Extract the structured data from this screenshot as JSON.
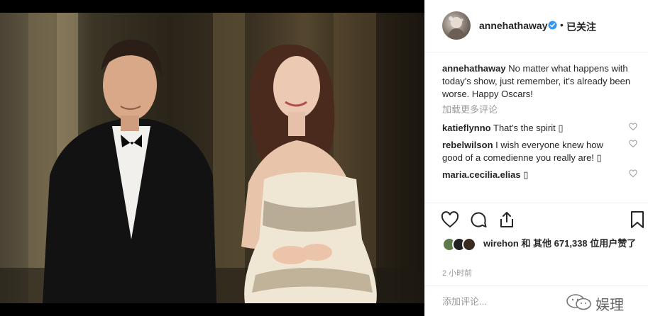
{
  "post": {
    "username": "annehathaway",
    "separator": "•",
    "follow_status": "已关注",
    "caption": "No matter what happens with today's show, just remember, it's already been worse. Happy Oscars!",
    "load_more": "加载更多评论"
  },
  "comments": [
    {
      "user": "katieflynno",
      "text": "That's the spirit ▯"
    },
    {
      "user": "rebelwilson",
      "text": "I wish everyone knew how good of a comedienne you really are! ▯"
    },
    {
      "user": "maria.cecilia.elias",
      "text": "▯"
    }
  ],
  "likes": {
    "text": "wirehon 和 其他 671,338 位用户赞了"
  },
  "timestamp": "2 小时前",
  "add_comment_placeholder": "添加评论...",
  "watermark": "娱理",
  "icons": {
    "like": "heart-icon",
    "comment": "comment-icon",
    "share": "share-icon",
    "save": "bookmark-icon",
    "verified": "verified-badge-icon"
  },
  "colors": {
    "verified": "#3897f0",
    "secondary_text": "#999999",
    "primary_text": "#262626",
    "divider": "#efefef"
  }
}
